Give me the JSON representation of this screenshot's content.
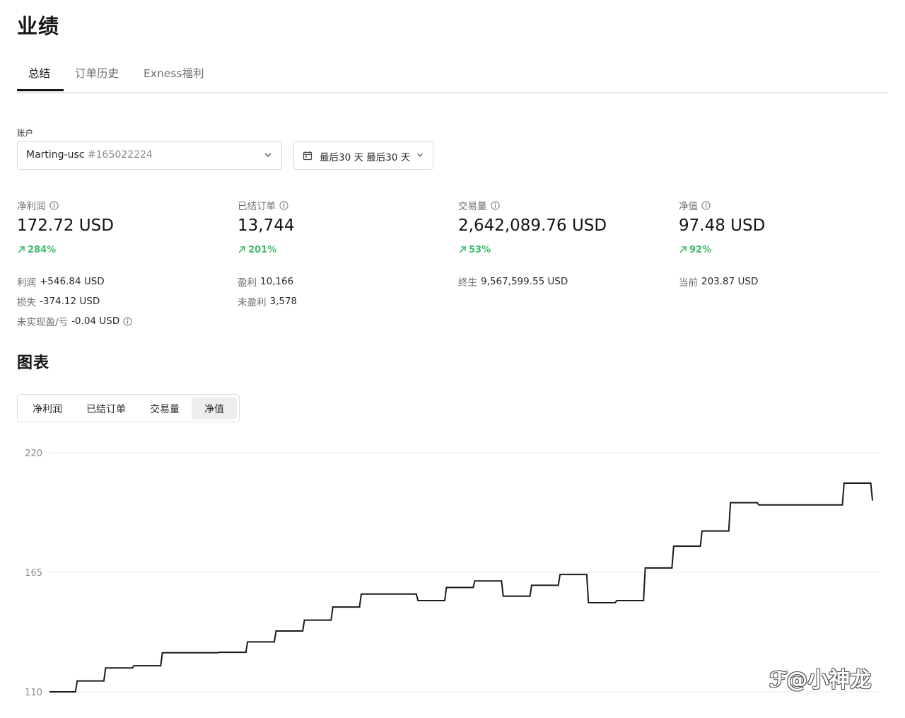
{
  "page": {
    "title": "业绩"
  },
  "tabs": [
    {
      "label": "总结",
      "active": true
    },
    {
      "label": "订单历史",
      "active": false
    },
    {
      "label": "Exness福利",
      "active": false
    }
  ],
  "account": {
    "label": "账户",
    "name": "Marting-usc",
    "number": "#165022224"
  },
  "date_range": {
    "label": "最后30 天 最后30 天"
  },
  "stats": [
    {
      "label": "净利润",
      "value": "172.72 USD",
      "change": "284%",
      "details": [
        {
          "key": "利润",
          "value": "+546.84 USD"
        },
        {
          "key": "损失",
          "value": "-374.12 USD"
        },
        {
          "key": "未实现盈/亏",
          "value": "-0.04 USD",
          "info": true
        }
      ]
    },
    {
      "label": "已结订单",
      "value": "13,744",
      "change": "201%",
      "details": [
        {
          "key": "盈利",
          "value": "10,166"
        },
        {
          "key": "未盈利",
          "value": "3,578"
        }
      ]
    },
    {
      "label": "交易量",
      "value": "2,642,089.76 USD",
      "change": "53%",
      "details": [
        {
          "key": "终生",
          "value": "9,567,599.55 USD"
        }
      ]
    },
    {
      "label": "净值",
      "value": "97.48 USD",
      "change": "92%",
      "details": [
        {
          "key": "当前",
          "value": "203.87 USD"
        }
      ]
    }
  ],
  "chart_section": {
    "title": "图表",
    "segments": [
      {
        "label": "净利润",
        "active": false
      },
      {
        "label": "已结订单",
        "active": false
      },
      {
        "label": "交易量",
        "active": false
      },
      {
        "label": "净值",
        "active": true
      }
    ]
  },
  "colors": {
    "positive": "#3dbb6a",
    "line": "#1a1a1a",
    "grid": "#e8e8e8"
  },
  "chart_data": {
    "type": "line",
    "series_label": "净值",
    "yticks": [
      110,
      165,
      220
    ],
    "ylim": [
      110,
      220
    ],
    "step": true,
    "grid": true,
    "points": [
      [
        0,
        110
      ],
      [
        1,
        115
      ],
      [
        2,
        121
      ],
      [
        3,
        122
      ],
      [
        4,
        128
      ],
      [
        5,
        128
      ],
      [
        6,
        128.2
      ],
      [
        7,
        133
      ],
      [
        8,
        138
      ],
      [
        9,
        143
      ],
      [
        10,
        149
      ],
      [
        11,
        155
      ],
      [
        12,
        155
      ],
      [
        13,
        152
      ],
      [
        14,
        158
      ],
      [
        15,
        161
      ],
      [
        16,
        154
      ],
      [
        17,
        159
      ],
      [
        18,
        164
      ],
      [
        19,
        151
      ],
      [
        20,
        152
      ],
      [
        21,
        167
      ],
      [
        22,
        177
      ],
      [
        23,
        184
      ],
      [
        24,
        197
      ],
      [
        25,
        196
      ],
      [
        26,
        196
      ],
      [
        27,
        196
      ],
      [
        28,
        206
      ],
      [
        29,
        198
      ]
    ]
  },
  "watermark": {
    "text": "ℱ@小神龙"
  }
}
